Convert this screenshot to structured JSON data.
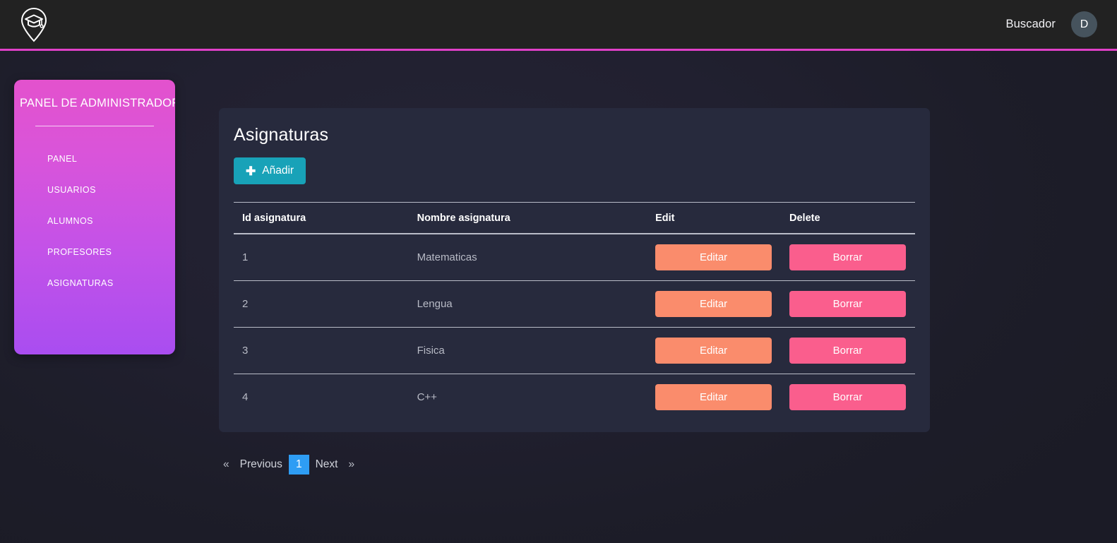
{
  "header": {
    "logo_icon": "graduation-cap-pin-icon",
    "nav_link": "Buscador",
    "avatar_initial": "D"
  },
  "sidebar": {
    "title": "PANEL DE ADMINISTRADOR",
    "items": [
      {
        "label": "PANEL"
      },
      {
        "label": "USUARIOS"
      },
      {
        "label": "ALUMNOS"
      },
      {
        "label": "PROFESORES"
      },
      {
        "label": "ASIGNATURAS"
      }
    ],
    "gradient_from": "#e352cd",
    "gradient_to": "#a94df0"
  },
  "main": {
    "title": "Asignaturas",
    "add_button": {
      "label": "Añadir",
      "icon": "plus-icon",
      "color": "#18a2b8"
    },
    "table": {
      "columns": [
        "Id asignatura",
        "Nombre asignatura",
        "Edit",
        "Delete"
      ],
      "rows": [
        {
          "id": "1",
          "nombre": "Matematicas",
          "edit_label": "Editar",
          "delete_label": "Borrar"
        },
        {
          "id": "2",
          "nombre": "Lengua",
          "edit_label": "Editar",
          "delete_label": "Borrar"
        },
        {
          "id": "3",
          "nombre": "Fisica",
          "edit_label": "Editar",
          "delete_label": "Borrar"
        },
        {
          "id": "4",
          "nombre": "C++",
          "edit_label": "Editar",
          "delete_label": "Borrar"
        }
      ],
      "edit_color": "#fa8c6c",
      "delete_color": "#fa5e8d"
    }
  },
  "pagination": {
    "first": "«",
    "previous": "Previous",
    "current": "1",
    "next": "Next",
    "last": "»",
    "active_color": "#2e9df4"
  },
  "theme": {
    "header_bg": "#222222",
    "header_accent": "#e040c8",
    "page_bg": "#1e1e2d",
    "card_bg": "#272a3d"
  }
}
